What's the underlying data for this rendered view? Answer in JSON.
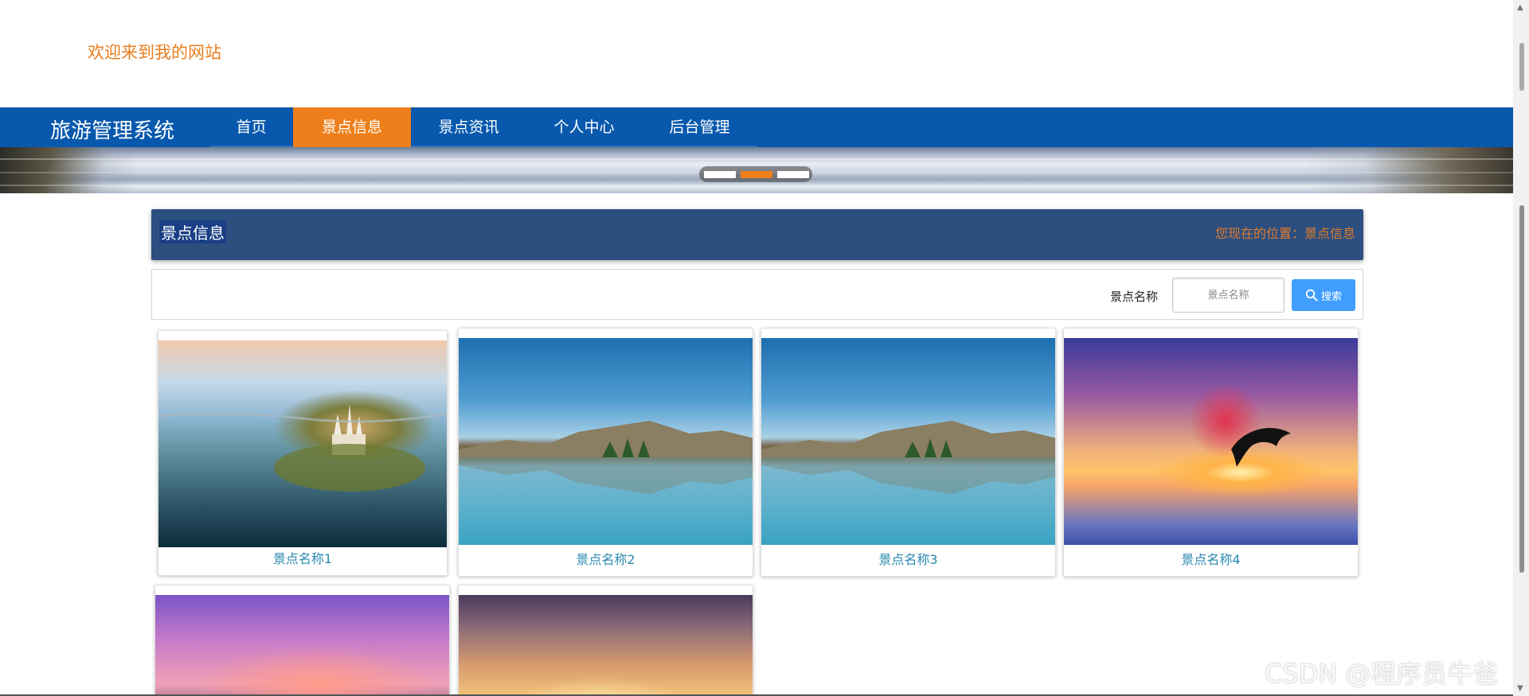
{
  "header": {
    "welcome": "欢迎来到我的网站"
  },
  "nav": {
    "brand": "旅游管理系统",
    "items": [
      {
        "label": "首页",
        "active": false
      },
      {
        "label": "景点信息",
        "active": true
      },
      {
        "label": "景点资讯",
        "active": false
      },
      {
        "label": "个人中心",
        "active": false
      },
      {
        "label": "后台管理",
        "active": false
      }
    ]
  },
  "banner": {
    "slides": 3,
    "active_slide": 2
  },
  "section": {
    "title": "景点信息",
    "breadcrumb": "您现在的位置：景点信息"
  },
  "search": {
    "label": "景点名称",
    "placeholder": "景点名称",
    "button": "搜索"
  },
  "cards": [
    {
      "name": "景点名称1",
      "image": "castle-island-lake"
    },
    {
      "name": "景点名称2",
      "image": "mountain-lake-reflection"
    },
    {
      "name": "景点名称3",
      "image": "mountain-lake-reflection"
    },
    {
      "name": "景点名称4",
      "image": "dolphin-sunset"
    },
    {
      "name": "",
      "image": "pink-sky"
    },
    {
      "name": "",
      "image": "field-sunset"
    }
  ],
  "watermark": "CSDN @程序员牛爸",
  "colors": {
    "accent": "#ee7f1a",
    "nav_bg": "#0859ad",
    "title_bar_bg": "#2d4f7f",
    "button_bg": "#409eff",
    "card_name": "#2a8ab0"
  }
}
